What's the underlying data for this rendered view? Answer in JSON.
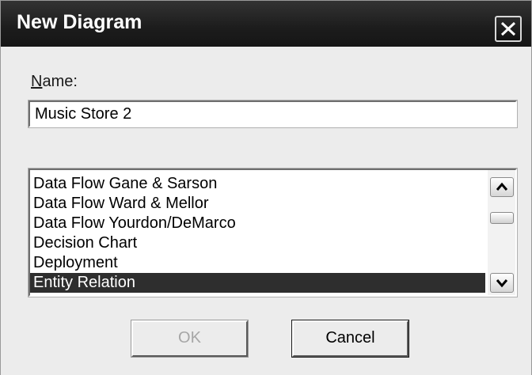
{
  "window": {
    "title": "New Diagram",
    "close_icon": "close-icon"
  },
  "name_field": {
    "label": "Name:",
    "value": "Music Store 2"
  },
  "diagram_types": {
    "items": [
      "Data Flow Gane & Sarson",
      "Data Flow Ward & Mellor",
      "Data Flow Yourdon/DeMarco",
      "Decision Chart",
      "Deployment",
      "Entity Relation"
    ],
    "selected": "Entity Relation"
  },
  "buttons": {
    "ok": "OK",
    "cancel": "Cancel",
    "ok_enabled": false
  },
  "colors": {
    "titlebar": "#1c1c1c",
    "selection": "#2e2e2e",
    "dialog_bg": "#ececec"
  }
}
